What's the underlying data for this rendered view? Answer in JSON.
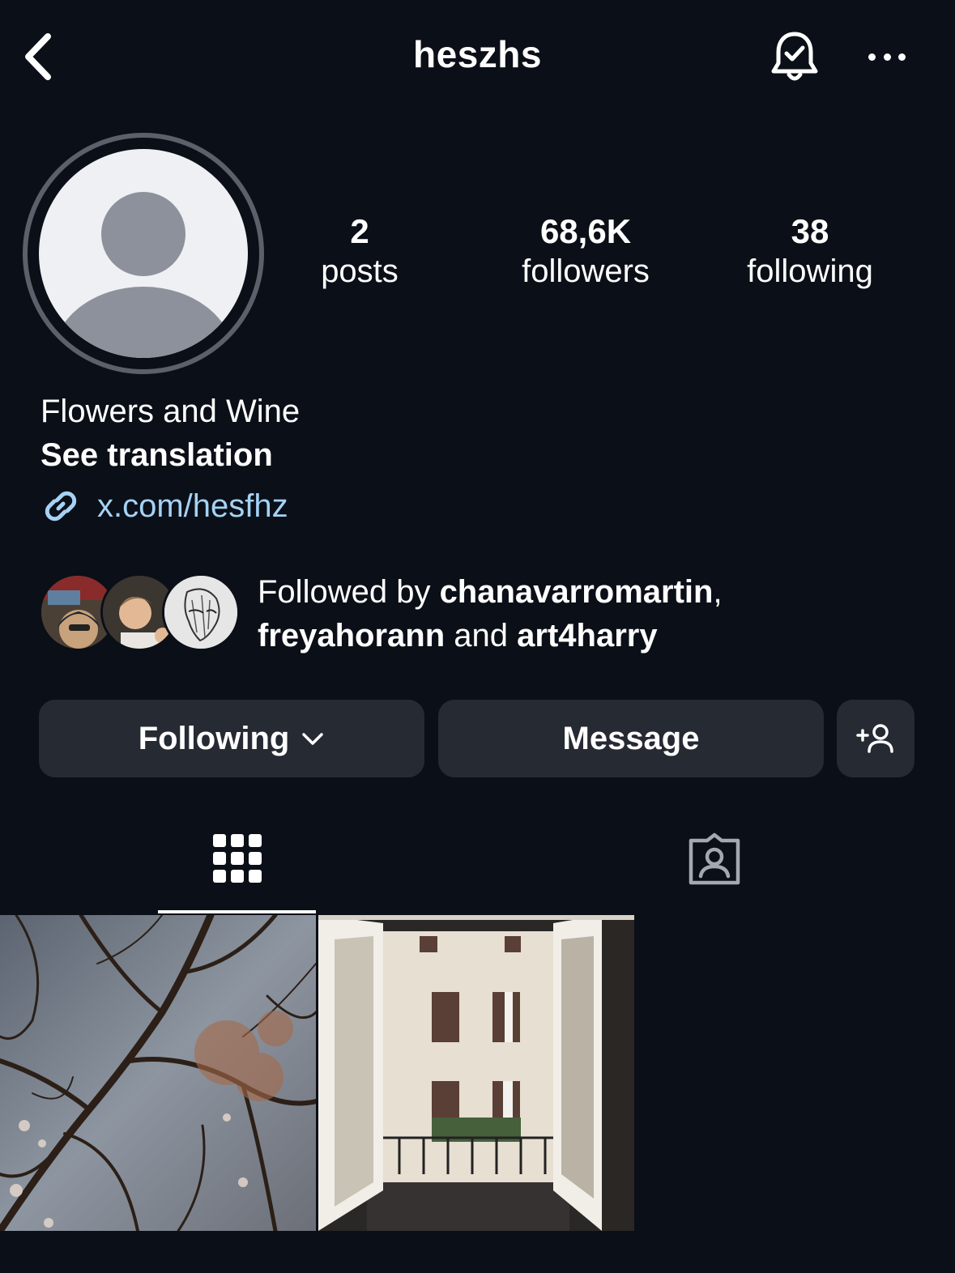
{
  "header": {
    "username": "heszhs",
    "back_icon": "chevron-left-icon",
    "notifications_icon": "bell-check-icon",
    "more_icon": "more-horizontal-icon"
  },
  "profile": {
    "avatar": "default-avatar",
    "stats": {
      "posts": {
        "value": "2",
        "label": "posts"
      },
      "followers": {
        "value": "68,6K",
        "label": "followers"
      },
      "following": {
        "value": "38",
        "label": "following"
      }
    },
    "bio": "Flowers and Wine",
    "see_translation": "See translation",
    "link": "x.com/hesfhz",
    "link_color": "#a5d2f5"
  },
  "followed_by": {
    "prefix": "Followed by ",
    "user1": "chanavarromartin",
    "sep1": ",",
    "user2": "freyahorann",
    "and": " and ",
    "user3": "art4harry"
  },
  "actions": {
    "following_label": "Following",
    "message_label": "Message",
    "add_icon": "add-person-icon"
  },
  "tabs": [
    {
      "icon": "grid-icon",
      "active": true
    },
    {
      "icon": "tagged-icon",
      "active": false
    }
  ],
  "posts": [
    {
      "description": "bare tree branches with blossoms"
    },
    {
      "description": "open window view of building facade"
    }
  ],
  "colors": {
    "background": "#0b0f17",
    "button": "#252a33",
    "text": "#ffffff"
  }
}
